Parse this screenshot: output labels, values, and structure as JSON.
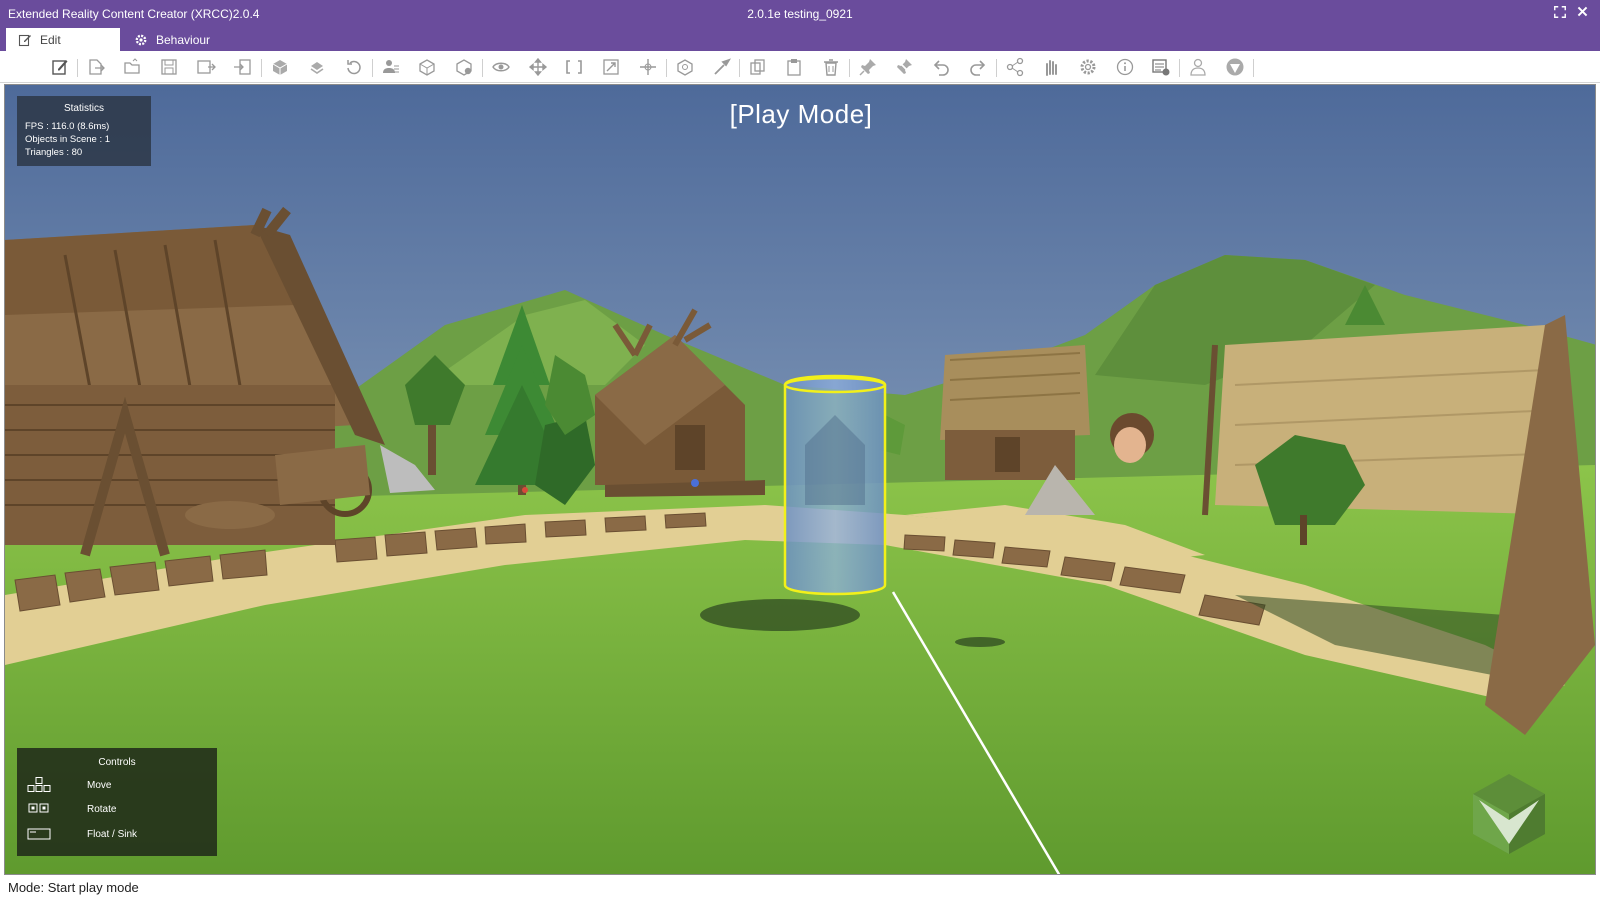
{
  "window": {
    "app_title": "Extended Reality Content Creator (XRCC)2.0.4",
    "doc_title": "2.0.1e testing_0921",
    "maximize_icon": "maximize-icon",
    "close_icon": "close-icon"
  },
  "tabs": [
    {
      "label": "Edit",
      "icon": "edit-icon",
      "active": true
    },
    {
      "label": "Behaviour",
      "icon": "gear-icon",
      "active": false
    }
  ],
  "toolbar": {
    "tools": [
      "edit-note-icon",
      "export-icon",
      "open-folder-icon",
      "save-icon",
      "save-as-icon",
      "import-icon",
      "package-icon",
      "publish-icon",
      "refresh-icon",
      "user-location-icon",
      "cube-add-icon",
      "cube-remove-icon",
      "eye-icon",
      "move-icon",
      "rotate-icon",
      "scale-icon",
      "pivot-icon",
      "object-icon",
      "brush-icon",
      "copy-icon",
      "paste-icon",
      "delete-icon",
      "pin-icon",
      "unpin-icon",
      "undo-icon",
      "redo-icon",
      "share-icon",
      "hand-icon",
      "settings-icon",
      "info-icon",
      "report-icon",
      "avatar-icon",
      "help-icon"
    ]
  },
  "viewport": {
    "mode_label": "[Play Mode]",
    "statistics": {
      "title": "Statistics",
      "lines": [
        "FPS : 116.0 (8.6ms)",
        "Objects in Scene : 1",
        "Triangles : 80"
      ]
    },
    "controls": {
      "title": "Controls",
      "items": [
        {
          "label": "Move",
          "icon": "keyboard-arrows-icon"
        },
        {
          "label": "Rotate",
          "icon": "keyboard-keys-icon"
        },
        {
          "label": "Float / Sink",
          "icon": "spacebar-icon"
        }
      ]
    },
    "nav_cube_icon": "navigation-cube-icon",
    "colors": {
      "sky_top": "#4e6a9a",
      "sky_bottom": "#a8c0d2",
      "grass": "#7cb342",
      "path": "#e2cf94",
      "wood": "#8a6a46",
      "selection_outline": "#f2f01a"
    }
  },
  "status_bar": {
    "text": "Mode: Start play mode"
  }
}
